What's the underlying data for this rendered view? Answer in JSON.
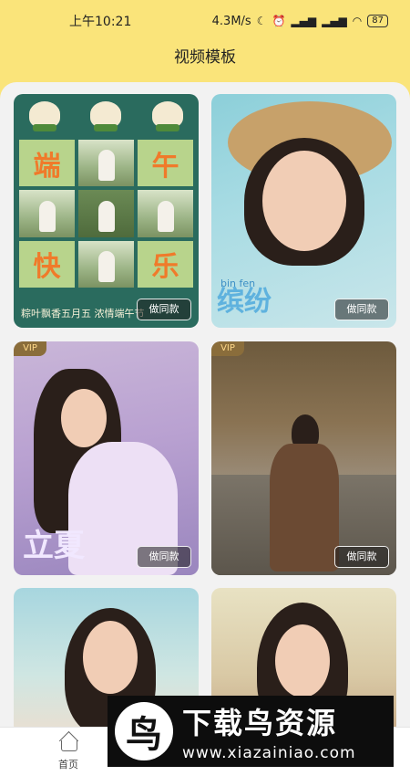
{
  "status": {
    "time": "上午10:21",
    "speed": "4.3M/s",
    "battery": "87"
  },
  "header": {
    "title": "视频模板"
  },
  "cards": [
    {
      "vip": "",
      "button": "做同款",
      "grid_chars": [
        "端",
        "午",
        "快",
        "乐"
      ],
      "caption": "粽叶飘香五月五 浓情端午节"
    },
    {
      "vip": "",
      "button": "做同款",
      "pinyin": "bin   fen",
      "word": "缤纷"
    },
    {
      "vip": "VIP",
      "button": "做同款",
      "title": "立夏"
    },
    {
      "vip": "VIP",
      "button": "做同款"
    },
    {},
    {}
  ],
  "nav": {
    "home": "首页"
  },
  "watermark": {
    "title": "下载鸟资源",
    "url": "www.xiazainiao.com"
  }
}
